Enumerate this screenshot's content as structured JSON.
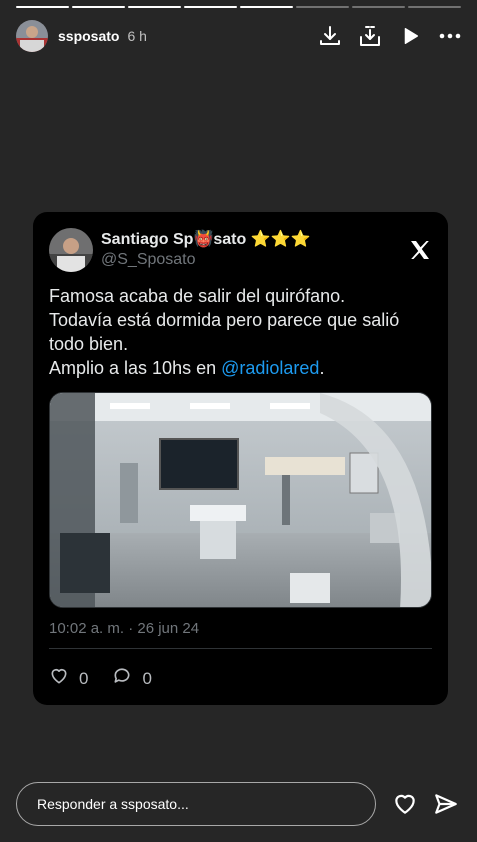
{
  "story": {
    "progress_segments": 8,
    "progress_done": 5,
    "username": "ssposato",
    "time_ago": "6 h",
    "header_icons": [
      "download-icon",
      "add-to-story-icon",
      "play-icon",
      "more-icon"
    ]
  },
  "tweet": {
    "name": "Santiago Sp👹sato ⭐⭐⭐",
    "handle": "@S_Sposato",
    "text_lines": [
      "Famosa acaba de salir del quirófano.",
      "Todavía está dormida pero parece que salió",
      "todo bien."
    ],
    "text_last_prefix": "Amplio a las 10hs en ",
    "mention": "@radiolared",
    "text_last_suffix": ".",
    "date": "10:02 a. m. · 26 jun 24",
    "likes": "0",
    "replies": "0"
  },
  "footer": {
    "reply_placeholder": "Responder a ssposato..."
  },
  "colors": {
    "background": "#262626",
    "card": "#000000",
    "mention": "#1d9bf0"
  }
}
